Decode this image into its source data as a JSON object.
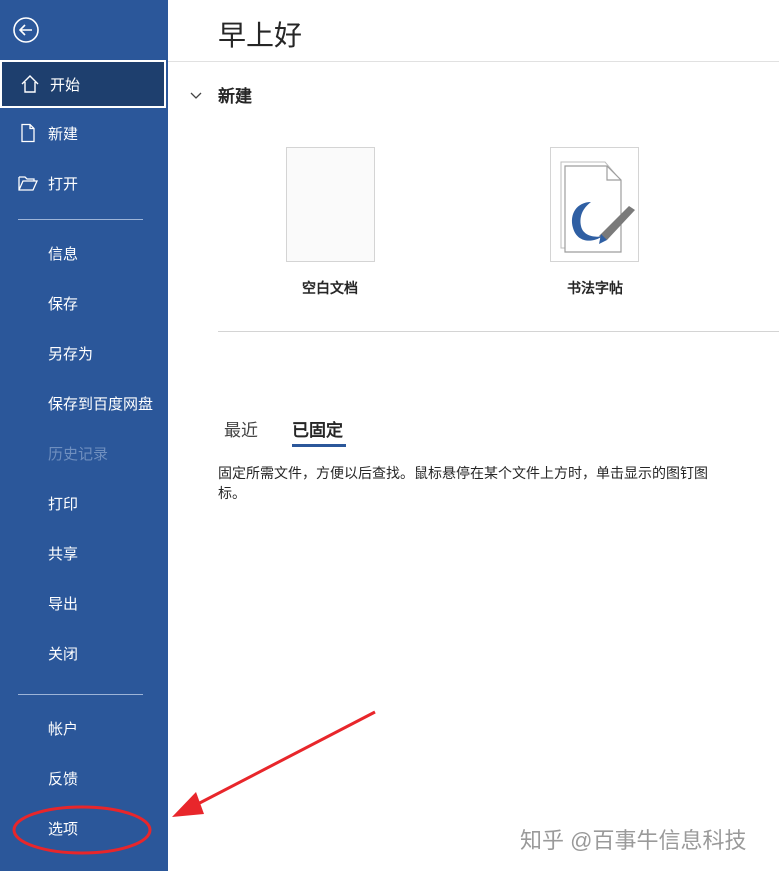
{
  "sidebar": {
    "top_items": [
      {
        "label": "开始",
        "icon": "home-icon"
      },
      {
        "label": "新建",
        "icon": "new-document-icon"
      },
      {
        "label": "打开",
        "icon": "open-folder-icon"
      }
    ],
    "middle_items": [
      {
        "label": "信息"
      },
      {
        "label": "保存"
      },
      {
        "label": "另存为"
      },
      {
        "label": "保存到百度网盘"
      },
      {
        "label": "历史记录"
      },
      {
        "label": "打印"
      },
      {
        "label": "共享"
      },
      {
        "label": "导出"
      },
      {
        "label": "关闭"
      }
    ],
    "bottom_items": [
      {
        "label": "帐户"
      },
      {
        "label": "反馈"
      },
      {
        "label": "选项"
      }
    ],
    "background_color": "#2b579a"
  },
  "main": {
    "greeting": "早上好",
    "new_section": {
      "title": "新建",
      "templates": [
        {
          "label": "空白文档"
        },
        {
          "label": "书法字帖"
        }
      ]
    },
    "tabs": [
      {
        "label": "最近"
      },
      {
        "label": "已固定"
      }
    ],
    "pinned_description": "固定所需文件，方便以后查找。鼠标悬停在某个文件上方时，单击显示的图钉图标。"
  },
  "watermark": "知乎 @百事牛信息科技",
  "annotation_color": "#e8262b"
}
